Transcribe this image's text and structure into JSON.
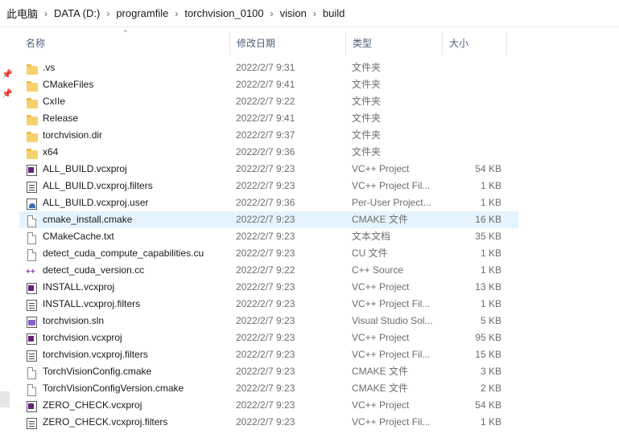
{
  "breadcrumb": [
    "此电脑",
    "DATA (D:)",
    "programfile",
    "torchvision_0100",
    "vision",
    "build"
  ],
  "columns": {
    "name": "名称",
    "date": "修改日期",
    "type": "类型",
    "size": "大小"
  },
  "files": [
    {
      "name": ".vs",
      "date": "2022/2/7 9:31",
      "type": "文件夹",
      "size": "",
      "icon": "folder-icon"
    },
    {
      "name": "CMakeFiles",
      "date": "2022/2/7 9:41",
      "type": "文件夹",
      "size": "",
      "icon": "folder-icon"
    },
    {
      "name": "CxIIe",
      "date": "2022/2/7 9:22",
      "type": "文件夹",
      "size": "",
      "icon": "folder-icon"
    },
    {
      "name": "Release",
      "date": "2022/2/7 9:41",
      "type": "文件夹",
      "size": "",
      "icon": "folder-icon"
    },
    {
      "name": "torchvision.dir",
      "date": "2022/2/7 9:37",
      "type": "文件夹",
      "size": "",
      "icon": "folder-icon"
    },
    {
      "name": "x64",
      "date": "2022/2/7 9:36",
      "type": "文件夹",
      "size": "",
      "icon": "folder-icon"
    },
    {
      "name": "ALL_BUILD.vcxproj",
      "date": "2022/2/7 9:23",
      "type": "VC++ Project",
      "size": "54 KB",
      "icon": "vcxproj-icon"
    },
    {
      "name": "ALL_BUILD.vcxproj.filters",
      "date": "2022/2/7 9:23",
      "type": "VC++ Project Fil...",
      "size": "1 KB",
      "icon": "filters-icon"
    },
    {
      "name": "ALL_BUILD.vcxproj.user",
      "date": "2022/2/7 9:36",
      "type": "Per-User Project...",
      "size": "1 KB",
      "icon": "user-project-icon"
    },
    {
      "name": "cmake_install.cmake",
      "date": "2022/2/7 9:23",
      "type": "CMAKE 文件",
      "size": "16 KB",
      "icon": "document-icon",
      "selected": true
    },
    {
      "name": "CMakeCache.txt",
      "date": "2022/2/7 9:23",
      "type": "文本文档",
      "size": "35 KB",
      "icon": "document-icon"
    },
    {
      "name": "detect_cuda_compute_capabilities.cu",
      "date": "2022/2/7 9:23",
      "type": "CU 文件",
      "size": "1 KB",
      "icon": "document-icon"
    },
    {
      "name": "detect_cuda_version.cc",
      "date": "2022/2/7 9:22",
      "type": "C++ Source",
      "size": "1 KB",
      "icon": "cpp-source-icon"
    },
    {
      "name": "INSTALL.vcxproj",
      "date": "2022/2/7 9:23",
      "type": "VC++ Project",
      "size": "13 KB",
      "icon": "vcxproj-icon"
    },
    {
      "name": "INSTALL.vcxproj.filters",
      "date": "2022/2/7 9:23",
      "type": "VC++ Project Fil...",
      "size": "1 KB",
      "icon": "filters-icon"
    },
    {
      "name": "torchvision.sln",
      "date": "2022/2/7 9:23",
      "type": "Visual Studio Sol...",
      "size": "5 KB",
      "icon": "solution-icon"
    },
    {
      "name": "torchvision.vcxproj",
      "date": "2022/2/7 9:23",
      "type": "VC++ Project",
      "size": "95 KB",
      "icon": "vcxproj-icon"
    },
    {
      "name": "torchvision.vcxproj.filters",
      "date": "2022/2/7 9:23",
      "type": "VC++ Project Fil...",
      "size": "15 KB",
      "icon": "filters-icon"
    },
    {
      "name": "TorchVisionConfig.cmake",
      "date": "2022/2/7 9:23",
      "type": "CMAKE 文件",
      "size": "3 KB",
      "icon": "document-icon"
    },
    {
      "name": "TorchVisionConfigVersion.cmake",
      "date": "2022/2/7 9:23",
      "type": "CMAKE 文件",
      "size": "2 KB",
      "icon": "document-icon"
    },
    {
      "name": "ZERO_CHECK.vcxproj",
      "date": "2022/2/7 9:23",
      "type": "VC++ Project",
      "size": "54 KB",
      "icon": "vcxproj-icon"
    },
    {
      "name": "ZERO_CHECK.vcxproj.filters",
      "date": "2022/2/7 9:23",
      "type": "VC++ Project Fil...",
      "size": "1 KB",
      "icon": "filters-icon"
    }
  ],
  "colors": {
    "selection": "#e5f3ff",
    "header_text": "#4c607a",
    "folder": "#f6d26e"
  }
}
